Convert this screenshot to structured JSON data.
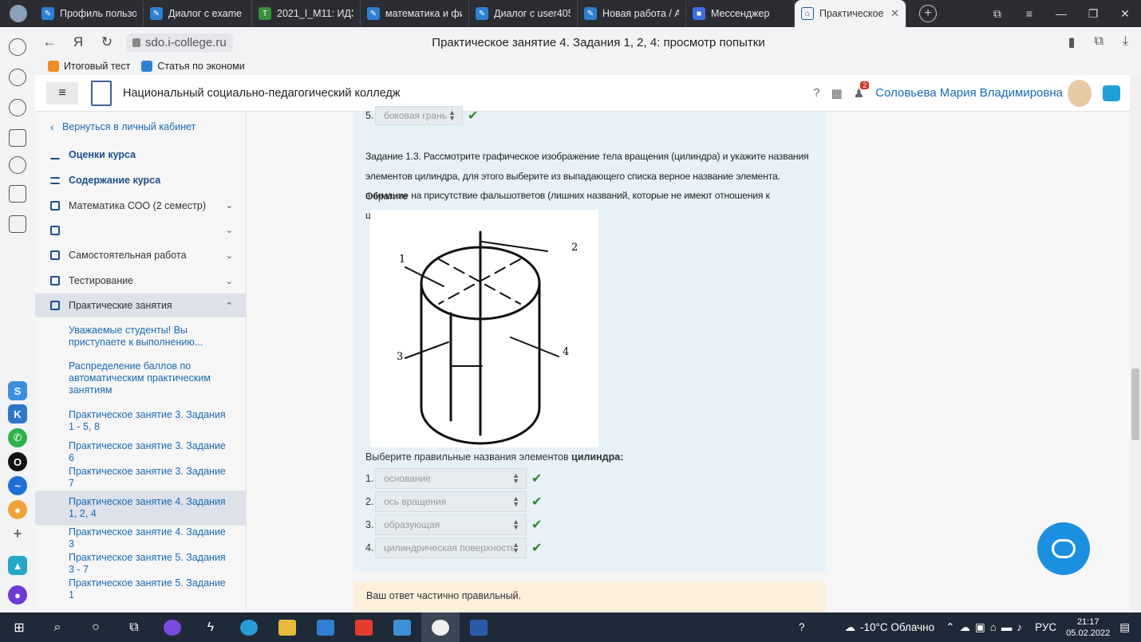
{
  "browser": {
    "tabs": [
      {
        "label": "Профиль пользо"
      },
      {
        "label": "Диалог с exame"
      },
      {
        "label": "2021_I_M11: ИДЗ"
      },
      {
        "label": "математика и фи"
      },
      {
        "label": "Диалог с user405"
      },
      {
        "label": "Новая работа / А"
      },
      {
        "label": "Мессенджер"
      },
      {
        "label": "Практическое"
      }
    ],
    "url": "sdo.i-college.ru",
    "page_title": "Практическое занятие 4. Задания 1, 2, 4: просмотр попытки",
    "bookmarks": [
      "Итоговый тест",
      "Статья по экономи"
    ]
  },
  "header": {
    "college_name": "Национальный социально-педагогический колледж",
    "notification_count": "2",
    "user_name": "Соловьева Мария Владимировна"
  },
  "sidebar": {
    "back": "Вернуться в личный кабинет",
    "grades": "Оценки курса",
    "contents": "Содержание курса",
    "sections": [
      {
        "label": "Математика СОО (2 семестр)"
      },
      {
        "label": ""
      },
      {
        "label": "Самостоятельная работа"
      },
      {
        "label": "Тестирование"
      },
      {
        "label": "Практические занятия"
      }
    ],
    "links": [
      {
        "label": "Уважаемые студенты! Вы приступаете к выполнению..."
      },
      {
        "label": "Распределение баллов по автоматическим практическим занятиям"
      },
      {
        "label": "Практическое занятие 3. Задания 1 - 5, 8"
      },
      {
        "label": "Практическое занятие 3. Задание 6"
      },
      {
        "label": "Практическое занятие 3. Задание 7"
      },
      {
        "label": "Практическое занятие 4. Задания 1, 2, 4"
      },
      {
        "label": "Практическое занятие 4. Задание 3"
      },
      {
        "label": "Практическое занятие 5. Задания 3 - 7"
      },
      {
        "label": "Практическое занятие 5. Задание 1"
      }
    ]
  },
  "question": {
    "prev_item": {
      "num": "5.",
      "value": "боковая грань"
    },
    "text_lines": [
      "Задание 1.3. Рассмотрите графическое изображение тела вращения (цилиндра) и укажите названия",
      "элементов  цилиндра, для этого выберите из выпадающего списка верное название элемента. Обратите",
      "внимание на присутствие фальшответов (лишних названий, которые не имеют отношения к цилиндру)."
    ],
    "figure_labels": [
      "1",
      "2",
      "3",
      "4"
    ],
    "prompt_prefix": "Выберите правильные названия элементов",
    "prompt_bold": "цилиндра:",
    "answers": [
      {
        "num": "1.",
        "value": "основание"
      },
      {
        "num": "2.",
        "value": "ось вращения"
      },
      {
        "num": "3.",
        "value": "образующая"
      },
      {
        "num": "4.",
        "value": "цилиндрическая поверхность"
      }
    ],
    "feedback": "Ваш ответ частично правильный."
  },
  "taskbar": {
    "weather": "-10°C  Облачно",
    "lang": "РУС",
    "time": "21:17",
    "date": "05.02.2022"
  },
  "colors": {
    "accent": "#1b6ab3",
    "question_bg": "#e6f2f8",
    "feedback_bg": "#fcefdc",
    "check": "#2d8a2d"
  }
}
